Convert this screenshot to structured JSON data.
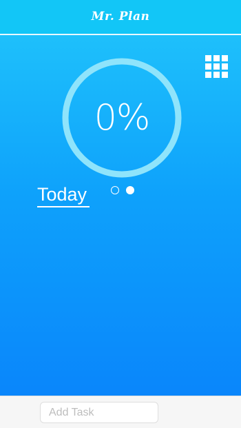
{
  "app": {
    "title": "Mr. Plan"
  },
  "progress": {
    "value": 0,
    "display": "0%"
  },
  "view": {
    "label": "Today",
    "pages": 2,
    "active_page": 2
  },
  "footer": {
    "add_task_placeholder": "Add Task",
    "add_task_value": ""
  },
  "icons": {
    "menu": "grid-icon"
  },
  "colors": {
    "header": "#12c6f7",
    "gradient_top": "#1ec0fb",
    "gradient_bottom": "#0a86fb",
    "ring": "#8fe4fb",
    "text": "#ffffff",
    "footer": "#f6f6f6"
  }
}
